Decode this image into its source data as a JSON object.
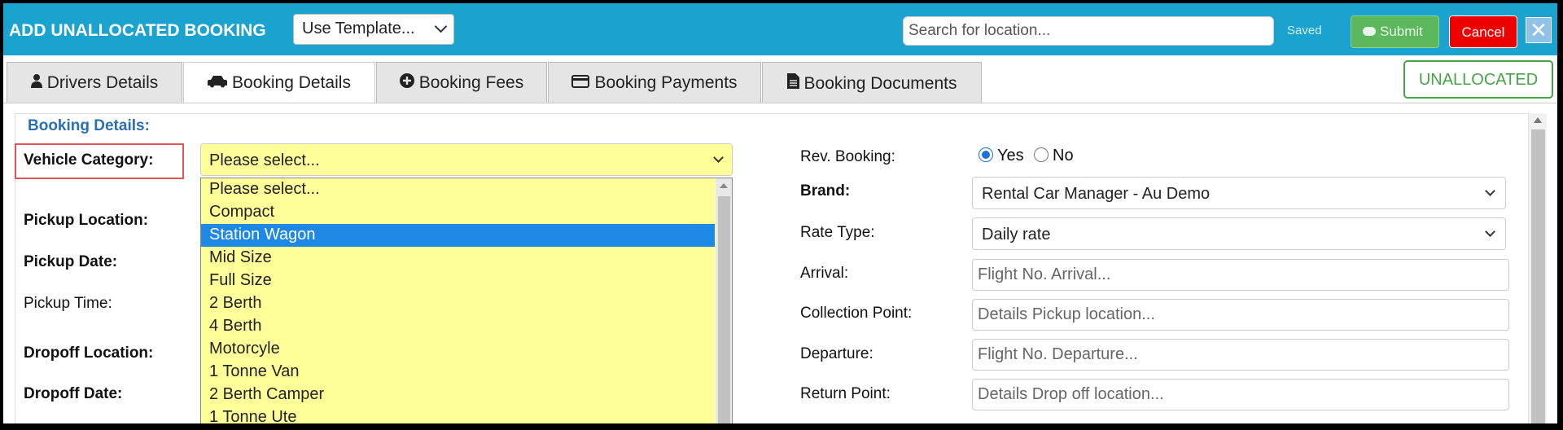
{
  "header": {
    "title": "ADD UNALLOCATED BOOKING",
    "template_select": "Use Template...",
    "search_placeholder": "Search for location...",
    "saved_label": "Saved",
    "submit_label": "Submit",
    "cancel_label": "Cancel",
    "close_glyph": "✕"
  },
  "tabs": [
    {
      "label": "Drivers Details",
      "icon": "user-icon"
    },
    {
      "label": "Booking Details",
      "icon": "car-icon"
    },
    {
      "label": "Booking Fees",
      "icon": "plus-circle-icon"
    },
    {
      "label": "Booking Payments",
      "icon": "credit-card-icon"
    },
    {
      "label": "Booking Documents",
      "icon": "file-icon"
    }
  ],
  "status_badge": "UNALLOCATED",
  "section_title": "Booking Details:",
  "left_labels": {
    "vehicle_category": "Vehicle Category:",
    "pickup_location": "Pickup Location:",
    "pickup_date": "Pickup Date:",
    "pickup_time": "Pickup Time:",
    "dropoff_location": "Dropoff Location:",
    "dropoff_date": "Dropoff Date:"
  },
  "vehicle_category": {
    "selected": "Please select...",
    "options": [
      "Please select...",
      "Compact",
      "Station Wagon",
      "Mid Size",
      "Full Size",
      "2 Berth",
      "4 Berth",
      "Motorcyle",
      "1 Tonne Van",
      "2 Berth Camper",
      "1 Tonne Ute"
    ],
    "highlighted": "Station Wagon"
  },
  "right": {
    "rev_booking_label": "Rev. Booking:",
    "rev_yes": "Yes",
    "rev_no": "No",
    "rev_value": "Yes",
    "brand_label": "Brand:",
    "brand_value": "Rental Car Manager - Au Demo",
    "rate_type_label": "Rate Type:",
    "rate_type_value": "Daily rate",
    "arrival_label": "Arrival:",
    "arrival_placeholder": "Flight No. Arrival...",
    "collection_label": "Collection Point:",
    "collection_placeholder": "Details Pickup location...",
    "departure_label": "Departure:",
    "departure_placeholder": "Flight No. Departure...",
    "return_label": "Return Point:",
    "return_placeholder": "Details Drop off location..."
  },
  "colors": {
    "header_bg": "#1aa3cf",
    "submit": "#5cb85c",
    "cancel": "#ee0000",
    "badge": "#46a346",
    "dropdown_bg": "#ffff99",
    "highlight": "#1e88e5",
    "section_title": "#2a6fb0"
  }
}
